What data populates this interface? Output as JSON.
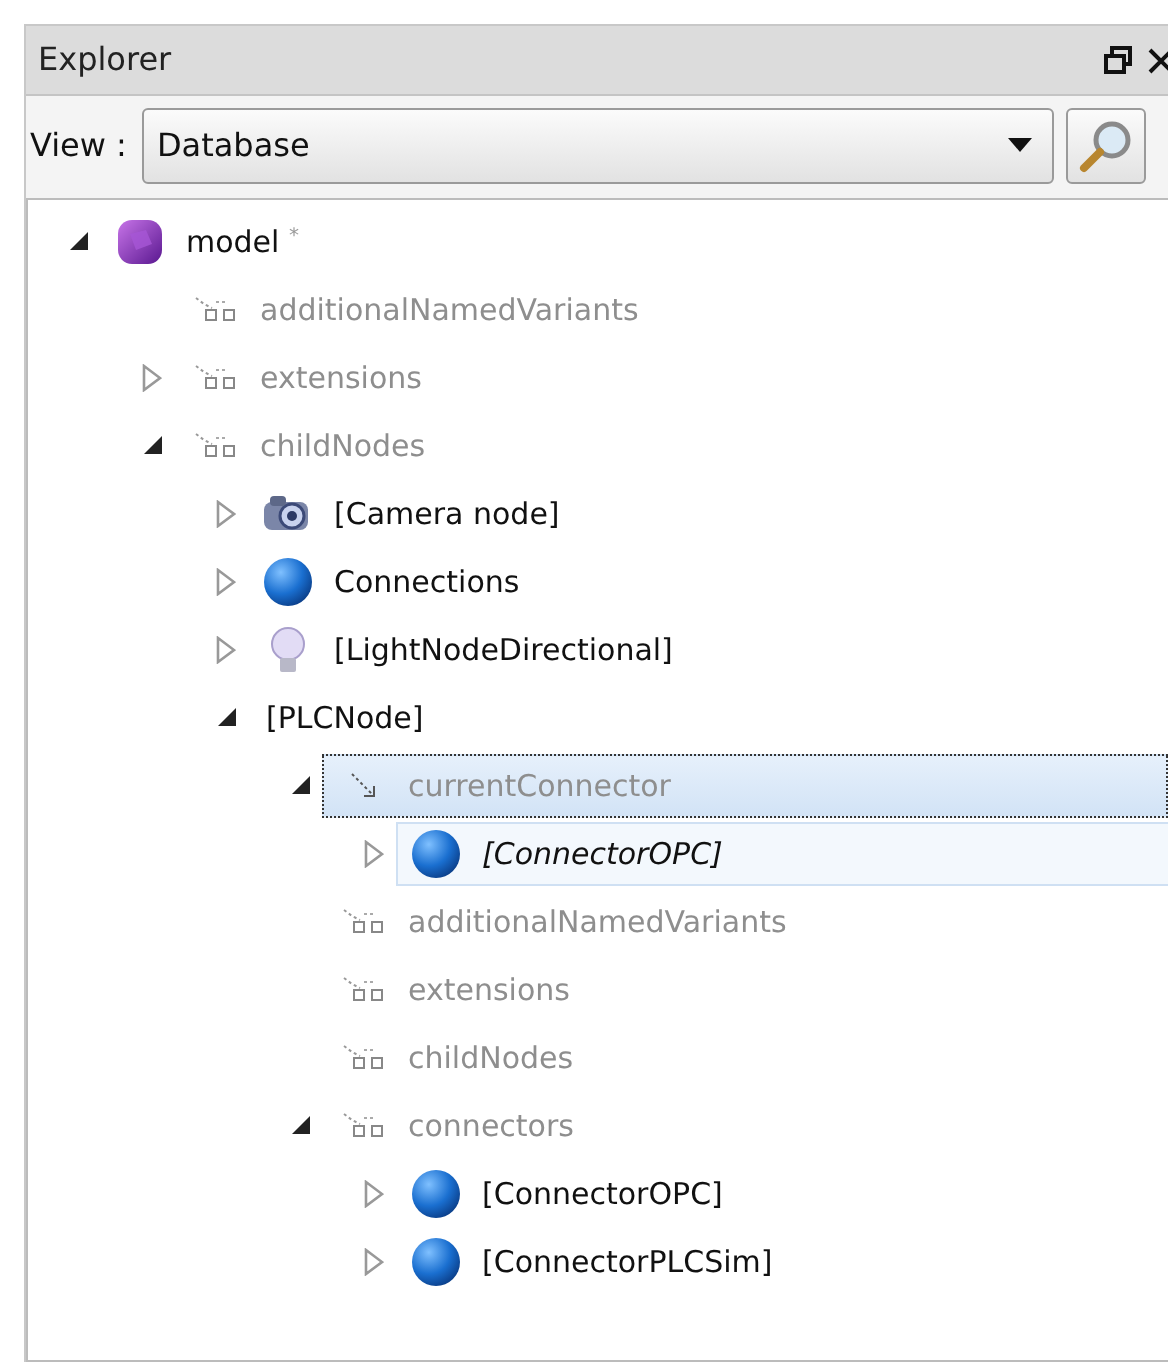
{
  "panel": {
    "title": "Explorer"
  },
  "view": {
    "label": "View :",
    "value": "Database"
  },
  "tree": [
    {
      "label": "model $^{*}$",
      "kind": "cube",
      "expanded": true,
      "selected": false,
      "highlighted": false,
      "italic": false,
      "children": [
        {
          "label": "additionalNamedVariants",
          "kind": "field",
          "selected": false,
          "highlighted": false,
          "italic": false
        },
        {
          "label": "extensions",
          "kind": "field",
          "expanded": false,
          "selected": false,
          "highlighted": false,
          "italic": false
        },
        {
          "label": "childNodes",
          "kind": "field",
          "expanded": true,
          "selected": false,
          "highlighted": false,
          "italic": false,
          "children": [
            {
              "label": "[Camera node]",
              "kind": "camera",
              "expanded": false,
              "selected": false,
              "highlighted": false,
              "italic": false
            },
            {
              "label": "Connections",
              "kind": "sphere",
              "expanded": false,
              "selected": false,
              "highlighted": false,
              "italic": false
            },
            {
              "label": "[LightNodeDirectional]",
              "kind": "bulb",
              "expanded": false,
              "selected": false,
              "highlighted": false,
              "italic": false
            },
            {
              "label": "[PLCNode]",
              "kind": "plain",
              "expanded": true,
              "selected": false,
              "highlighted": false,
              "italic": false,
              "children": [
                {
                  "label": "currentConnector",
                  "kind": "reference",
                  "expanded": true,
                  "selected": true,
                  "highlighted": false,
                  "italic": false,
                  "children": [
                    {
                      "label": "[ConnectorOPC]",
                      "kind": "sphere",
                      "expanded": false,
                      "selected": false,
                      "highlighted": true,
                      "italic": true
                    }
                  ]
                },
                {
                  "label": "additionalNamedVariants",
                  "kind": "field",
                  "selected": false,
                  "highlighted": false,
                  "italic": false
                },
                {
                  "label": "extensions",
                  "kind": "field",
                  "selected": false,
                  "highlighted": false,
                  "italic": false
                },
                {
                  "label": "childNodes",
                  "kind": "field",
                  "selected": false,
                  "highlighted": false,
                  "italic": false
                },
                {
                  "label": "connectors",
                  "kind": "field",
                  "expanded": true,
                  "selected": false,
                  "highlighted": false,
                  "italic": false,
                  "children": [
                    {
                      "label": "[ConnectorOPC]",
                      "kind": "sphere",
                      "expanded": false,
                      "selected": false,
                      "highlighted": false,
                      "italic": false
                    },
                    {
                      "label": "[ConnectorPLCSim]",
                      "kind": "sphere",
                      "expanded": false,
                      "selected": false,
                      "highlighted": false,
                      "italic": false
                    }
                  ]
                }
              ]
            }
          ]
        }
      ]
    }
  ]
}
